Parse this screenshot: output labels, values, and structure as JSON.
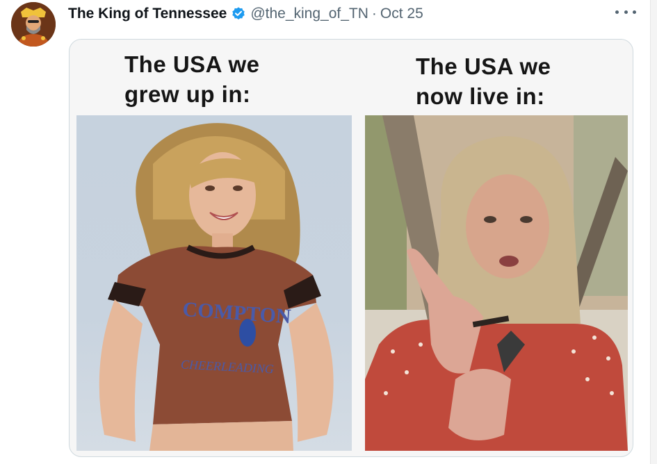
{
  "tweet": {
    "author": {
      "display_name": "The King of Tennessee",
      "handle": "@the_king_of_TN",
      "verified": true,
      "avatar_icon": "avatar-image"
    },
    "separator": "·",
    "date": "Oct 25",
    "more_icon": "more-options-icon"
  },
  "media": {
    "left_caption": "The USA we\ngrew up in:",
    "right_caption": "The USA we\nnow live in:",
    "left_photo": {
      "shirt_text_top": "COMPTON",
      "shirt_text_bottom": "CHEERLEADING"
    }
  },
  "colors": {
    "verified_blue": "#1d9bf0",
    "secondary_text": "#536471",
    "card_border": "#cfd9de"
  }
}
